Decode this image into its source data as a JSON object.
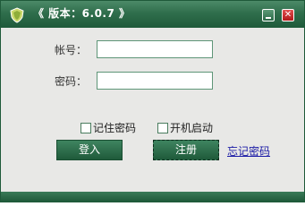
{
  "window": {
    "title": "《 版本：6.0.7 》",
    "close_glyph": "✕"
  },
  "form": {
    "account_label": "帐号：",
    "account_value": "",
    "password_label": "密码：",
    "password_value": "",
    "remember_label": "记住密码",
    "autostart_label": "开机启动"
  },
  "actions": {
    "login_label": "登入",
    "register_label": "注册",
    "forgot_label": "忘记密码"
  },
  "colors": {
    "accent": "#2f6e4c",
    "link": "#1a1aa6",
    "close": "#c02222"
  }
}
